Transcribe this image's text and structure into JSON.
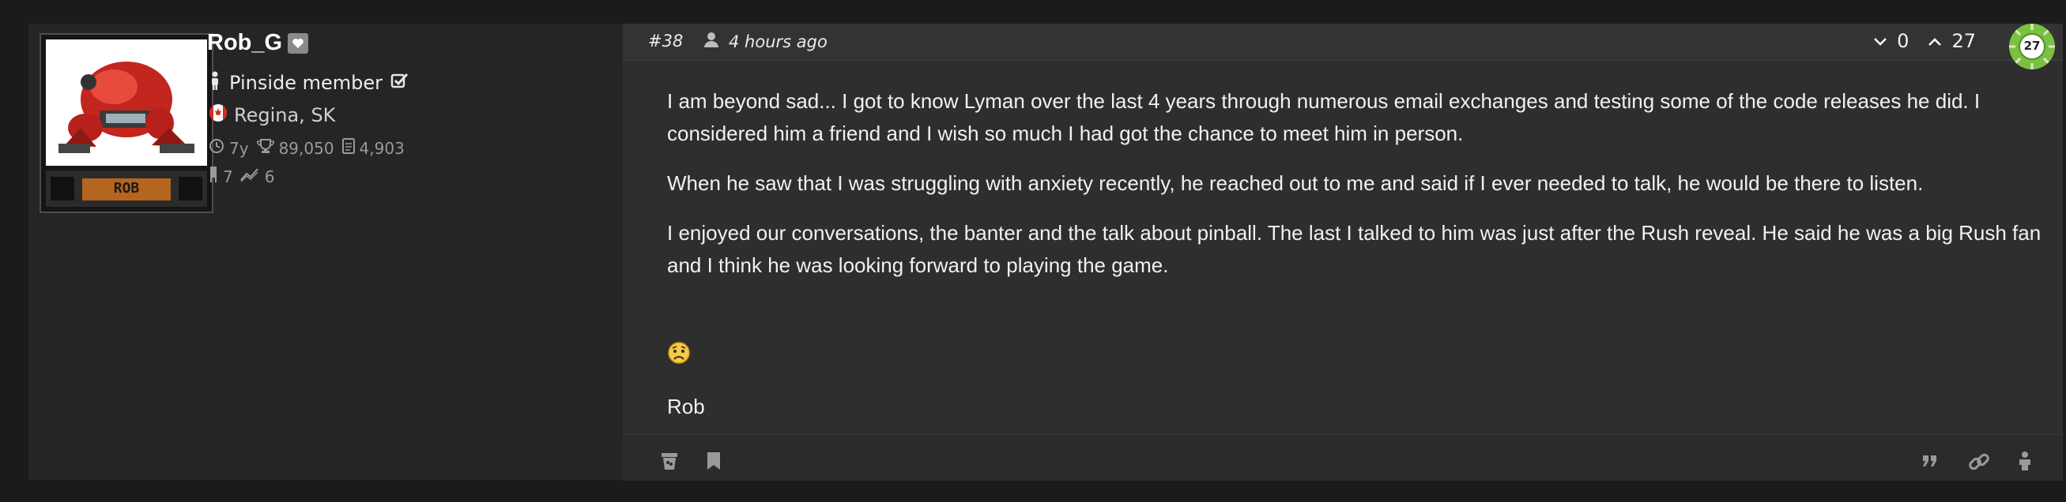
{
  "user": {
    "name": "Rob_G",
    "avatar_label": "ROB",
    "role": "Pinside member",
    "location": "Regina, SK",
    "country_flag": "canada-flag-icon",
    "years": "7y",
    "points": "89,050",
    "posts": "4,903",
    "machines": "7",
    "trades": "6",
    "level": "27"
  },
  "post": {
    "number": "#38",
    "time": "4 hours ago",
    "downvotes": "0",
    "upvotes": "27",
    "paragraphs": [
      "I am beyond sad... I got to know Lyman over the last 4 years through numerous email exchanges and testing some of the code releases he did. I considered him a friend and I wish so much I had got the chance to meet him in person.",
      "When he saw that I was struggling with anxiety recently, he reached out to me and said if I ever needed to talk, he would be there to listen.",
      "I enjoyed our conversations, the banter and the talk about pinball. The last I talked to him was just after the Rush reveal. He said he was a big Rush fan and I think he was looking forward to playing the game."
    ],
    "emoji": "worried-face",
    "signature": "Rob"
  },
  "footer_icons": [
    "trash-icon",
    "bookmark-icon",
    "quote-icon",
    "link-icon",
    "report-user-icon"
  ],
  "colors": {
    "background": "#1b1b1b",
    "post_bg": "#2e2e2e",
    "sidebar_bg": "#252525",
    "text": "#f1f1f1",
    "muted": "#9a9a9a",
    "level_green": "#7cc043"
  }
}
